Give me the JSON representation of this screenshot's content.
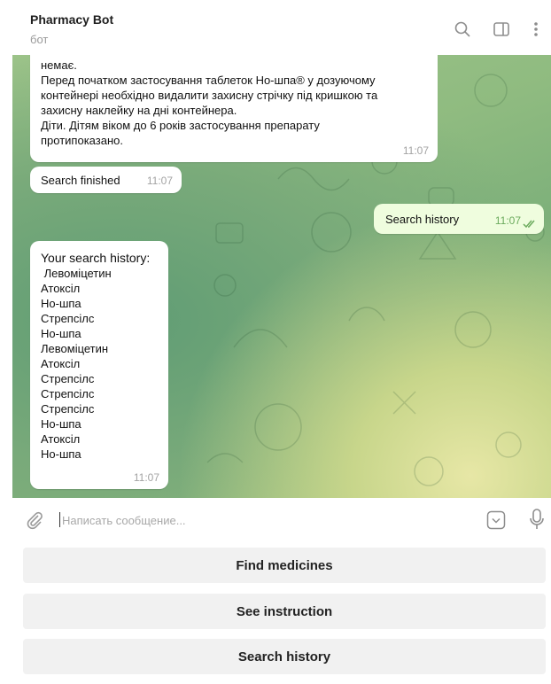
{
  "header": {
    "title": "Pharmacy Bot",
    "subtitle": "бот",
    "icons": [
      "search-icon",
      "sidebar-toggle-icon",
      "more-vertical-icon"
    ]
  },
  "messages": {
    "instruction_tail": {
      "lines": [
        "немає.",
        "Перед початком застосування таблеток Но-шпа® у дозуючому",
        "контейнері необхідно видалити захисну стрічку під кришкою та",
        "захисну наклейку на дні контейнера.",
        "Діти. Дітям віком до 6 років застосування препарату",
        "протипоказано."
      ],
      "time": "11:07"
    },
    "search_finished": {
      "text": "Search finished",
      "time": "11:07"
    },
    "user_search_history": {
      "text": "Search history",
      "time": "11:07",
      "status": "read"
    },
    "history_reply": {
      "header": "Your search history:",
      "items": [
        " Левоміцетин",
        "Атоксіл",
        "Но-шпа",
        "Стрепсілс",
        "Но-шпа",
        "Левоміцетин",
        "Атоксіл",
        "Стрепсілс",
        "Стрепсілс",
        "Стрепсілс",
        "Но-шпа",
        "Атоксіл",
        "Но-шпа"
      ],
      "time": "11:07"
    }
  },
  "composer": {
    "placeholder": "Написать сообщение...",
    "value": "",
    "icons": [
      "paperclip-icon",
      "bot-keyboard-icon",
      "microphone-icon"
    ]
  },
  "keyboard": {
    "buttons": [
      "Find medicines",
      "See instruction",
      "Search history"
    ]
  },
  "colors": {
    "incoming_bubble": "#ffffff",
    "outgoing_bubble": "#effdde",
    "read_checks": "#6cab5e",
    "keyboard_button": "#f1f1f1"
  }
}
